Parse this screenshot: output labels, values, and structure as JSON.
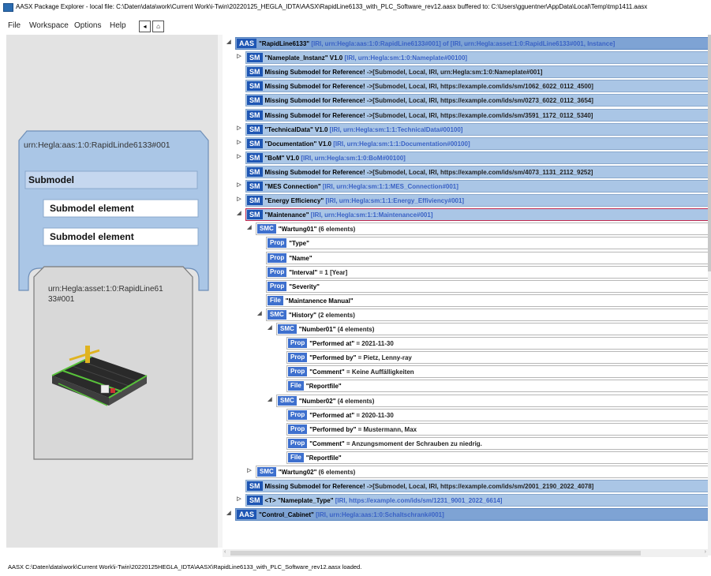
{
  "window": {
    "title": "AASX Package Explorer - local file: C:\\Daten\\data\\work\\Current Work\\i-Twin\\20220125_HEGLA_IDTA\\AASX\\RapidLine6133_with_PLC_Software_rev12.aasx buffered to: C:\\Users\\gguentner\\AppData\\Local\\Temp\\tmp1411.aasx"
  },
  "menu": [
    "File",
    "Workspace",
    "Options",
    "Help"
  ],
  "nav_icons": [
    "back-icon",
    "home-icon"
  ],
  "left_panel": {
    "aas_id": "urn:Hegla:aas:1:0:RapidLinde6133#001",
    "submodel_label": "Submodel",
    "element1_label": "Submodel element",
    "element2_label": "Submodel element",
    "asset_id": "urn:Hegla:asset:1:0:RapidLine6133#001"
  },
  "tree": [
    {
      "indent": 0,
      "exp": "◢",
      "tag": "AAS",
      "name": "\"RapidLine6133\"",
      "info": "[IRI, urn:Hegla:aas:1:0:RapidLine6133#001] of [IRI, urn:Hegla:asset:1:0:RapidLine6133#001, Instance]",
      "style": "aas"
    },
    {
      "indent": 1,
      "exp": "▷",
      "tag": "SM",
      "name": "\"Nameplate_Instanz\" V1.0",
      "info": "[IRI, urn:Hegla:sm:1:0:Nameplate#00100]",
      "style": "blue"
    },
    {
      "indent": 1,
      "exp": "",
      "tag": "SM",
      "name": "Missing Submodel for Reference!",
      "info": "->[Submodel, Local, IRI, urn:Hegla:sm:1:0:Nameplate#001]",
      "style": "blue"
    },
    {
      "indent": 1,
      "exp": "",
      "tag": "SM",
      "name": "Missing Submodel for Reference!",
      "info": "->[Submodel, Local, IRI, https://example.com/ids/sm/1062_6022_0112_4500]",
      "style": "blue"
    },
    {
      "indent": 1,
      "exp": "",
      "tag": "SM",
      "name": "Missing Submodel for Reference!",
      "info": "->[Submodel, Local, IRI, https://example.com/ids/sm/0273_6022_0112_3654]",
      "style": "blue"
    },
    {
      "indent": 1,
      "exp": "",
      "tag": "SM",
      "name": "Missing Submodel for Reference!",
      "info": "->[Submodel, Local, IRI, https://example.com/ids/sm/3591_1172_0112_5340]",
      "style": "blue"
    },
    {
      "indent": 1,
      "exp": "▷",
      "tag": "SM",
      "name": "\"TechnicalData\" V1.0",
      "info": "[IRI, urn:Hegla:sm:1:1:TechnicalData#00100]",
      "style": "blue"
    },
    {
      "indent": 1,
      "exp": "▷",
      "tag": "SM",
      "name": "\"Documentation\" V1.0",
      "info": "[IRI, urn:Hegla:sm:1:1:Documentation#00100]",
      "style": "blue"
    },
    {
      "indent": 1,
      "exp": "▷",
      "tag": "SM",
      "name": "\"BoM\" V1.0",
      "info": "[IRI, urn:Hegla:sm:1:0:BoM#00100]",
      "style": "blue"
    },
    {
      "indent": 1,
      "exp": "",
      "tag": "SM",
      "name": "Missing Submodel for Reference!",
      "info": "->[Submodel, Local, IRI, https://example.com/ids/sm/4073_1131_2112_9252]",
      "style": "blue"
    },
    {
      "indent": 1,
      "exp": "▷",
      "tag": "SM",
      "name": "\"MES Connection\"",
      "info": "[IRI, urn:Hegla:sm:1:1:MES_Connection#001]",
      "style": "blue"
    },
    {
      "indent": 1,
      "exp": "▷",
      "tag": "SM",
      "name": "\"Energy Efficiency\"",
      "info": "[IRI, urn:Hegla:sm:1:1:Energy_Effiviency#001]",
      "style": "blue"
    },
    {
      "indent": 1,
      "exp": "◢",
      "tag": "SM",
      "name": "\"Maintenance\"",
      "info": "[IRI, urn:Hegla:sm:1:1:Maintenance#001]",
      "style": "blue-sel"
    },
    {
      "indent": 2,
      "exp": "◢",
      "tag": "SMC",
      "name": "\"Wartung01\"",
      "info": "(6 elements)",
      "style": "white"
    },
    {
      "indent": 3,
      "exp": "",
      "tag": "Prop",
      "name": "\"Type\"",
      "info": "",
      "style": "white"
    },
    {
      "indent": 3,
      "exp": "",
      "tag": "Prop",
      "name": "\"Name\"",
      "info": "",
      "style": "white"
    },
    {
      "indent": 3,
      "exp": "",
      "tag": "Prop",
      "name": "\"Interval\"",
      "info": "= 1 [Year]",
      "style": "white"
    },
    {
      "indent": 3,
      "exp": "",
      "tag": "Prop",
      "name": "\"Severity\"",
      "info": "",
      "style": "white"
    },
    {
      "indent": 3,
      "exp": "",
      "tag": "File",
      "name": "\"Maintanence Manual\"",
      "info": "",
      "style": "white"
    },
    {
      "indent": 3,
      "exp": "◢",
      "tag": "SMC",
      "name": "\"History\"",
      "info": "(2 elements)",
      "style": "white"
    },
    {
      "indent": 4,
      "exp": "◢",
      "tag": "SMC",
      "name": "\"Number01\"",
      "info": "(4 elements)",
      "style": "white"
    },
    {
      "indent": 5,
      "exp": "",
      "tag": "Prop",
      "name": "\"Performed at\"",
      "info": "= 2021-11-30",
      "style": "white"
    },
    {
      "indent": 5,
      "exp": "",
      "tag": "Prop",
      "name": "\"Performed by\"",
      "info": "= Pietz, Lenny-ray",
      "style": "white"
    },
    {
      "indent": 5,
      "exp": "",
      "tag": "Prop",
      "name": "\"Comment\"",
      "info": "= Keine Auffälligkeiten",
      "style": "white"
    },
    {
      "indent": 5,
      "exp": "",
      "tag": "File",
      "name": "\"Reportfile\"",
      "info": "",
      "style": "white"
    },
    {
      "indent": 4,
      "exp": "◢",
      "tag": "SMC",
      "name": "\"Number02\"",
      "info": "(4 elements)",
      "style": "white"
    },
    {
      "indent": 5,
      "exp": "",
      "tag": "Prop",
      "name": "\"Performed at\"",
      "info": "= 2020-11-30",
      "style": "white"
    },
    {
      "indent": 5,
      "exp": "",
      "tag": "Prop",
      "name": "\"Performed by\"",
      "info": "= Mustermann, Max",
      "style": "white"
    },
    {
      "indent": 5,
      "exp": "",
      "tag": "Prop",
      "name": "\"Comment\"",
      "info": "= Anzungsmoment der Schrauben zu niedrig.",
      "style": "white"
    },
    {
      "indent": 5,
      "exp": "",
      "tag": "File",
      "name": "\"Reportfile\"",
      "info": "",
      "style": "white"
    },
    {
      "indent": 2,
      "exp": "▷",
      "tag": "SMC",
      "name": "\"Wartung02\"",
      "info": "(6 elements)",
      "style": "white"
    },
    {
      "indent": 1,
      "exp": "",
      "tag": "SM",
      "name": "Missing Submodel for Reference!",
      "info": "->[Submodel, Local, IRI, https://example.com/ids/sm/2001_2190_2022_4078]",
      "style": "blue"
    },
    {
      "indent": 1,
      "exp": "▷",
      "tag": "SM",
      "name": "<T> \"Nameplate_Type\"",
      "info": "[IRI, https://example.com/ids/sm/1231_9001_2022_6614]",
      "style": "blue"
    },
    {
      "indent": 0,
      "exp": "◢",
      "tag": "AAS",
      "name": "\"Control_Cabinet\"",
      "info": "[IRI, urn:Hegla:aas:1:0:Schaltschrank#001]",
      "style": "aas"
    }
  ],
  "status": "AASX C:\\Daten\\data\\work\\Current Work\\i-Twin\\20220125HEGLA_IDTA\\AASX\\RapidLine6133_with_PLC_Software_rev12.aasx loaded."
}
